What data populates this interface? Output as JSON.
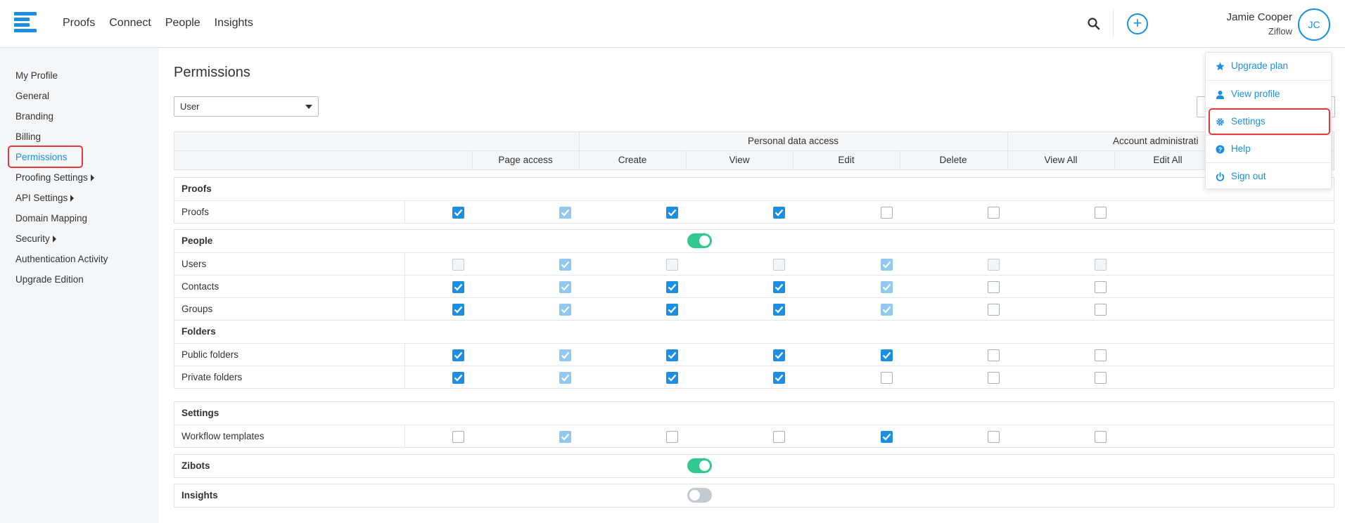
{
  "nav": {
    "items": [
      "Proofs",
      "Connect",
      "People",
      "Insights"
    ]
  },
  "user": {
    "name": "Jamie Cooper",
    "org": "Ziflow",
    "initials": "JC"
  },
  "sidebar": {
    "items": [
      {
        "label": "My Profile"
      },
      {
        "label": "General"
      },
      {
        "label": "Branding"
      },
      {
        "label": "Billing"
      },
      {
        "label": "Permissions",
        "active": true
      },
      {
        "label": "Proofing Settings",
        "caret": true
      },
      {
        "label": "API Settings",
        "caret": true
      },
      {
        "label": "Domain Mapping"
      },
      {
        "label": "Security",
        "caret": true
      },
      {
        "label": "Authentication Activity"
      },
      {
        "label": "Upgrade Edition"
      }
    ]
  },
  "page": {
    "title": "Permissions",
    "role_select": "User"
  },
  "table": {
    "group_headers": [
      "Personal data access",
      "Account administrati"
    ],
    "columns": [
      "Page access",
      "Create",
      "View",
      "Edit",
      "Delete",
      "View All",
      "Edit All"
    ],
    "sections": [
      {
        "title": "Proofs",
        "rows": [
          {
            "label": "Proofs",
            "cells": [
              "on",
              "on-light",
              "on",
              "on",
              "off",
              "off",
              "off"
            ]
          }
        ]
      },
      {
        "title": "People",
        "toggle": "on",
        "rows": [
          {
            "label": "Users",
            "cells": [
              "off-light",
              "on-light",
              "off-light",
              "off-light",
              "on-light",
              "off-light",
              "off-light"
            ]
          },
          {
            "label": "Contacts",
            "cells": [
              "on",
              "on-light",
              "on",
              "on",
              "on-light",
              "off",
              "off"
            ]
          },
          {
            "label": "Groups",
            "cells": [
              "on",
              "on-light",
              "on",
              "on",
              "on-light",
              "off",
              "off"
            ]
          }
        ]
      },
      {
        "title": "Folders",
        "rows": [
          {
            "label": "Public folders",
            "cells": [
              "on",
              "on-light",
              "on",
              "on",
              "on",
              "off",
              "off"
            ]
          },
          {
            "label": "Private folders",
            "cells": [
              "on",
              "on-light",
              "on",
              "on",
              "off",
              "off",
              "off"
            ]
          }
        ]
      },
      {
        "title": "Settings",
        "rows": [
          {
            "label": "Workflow templates",
            "cells": [
              "off",
              "on-light",
              "off",
              "off",
              "on",
              "off",
              "off"
            ]
          }
        ]
      },
      {
        "title": "Zibots",
        "toggle": "on",
        "rows": []
      },
      {
        "title": "Insights",
        "toggle": "off",
        "rows": []
      }
    ]
  },
  "menu": {
    "items": [
      {
        "label": "Upgrade plan",
        "icon": "star-icon"
      },
      {
        "label": "View profile",
        "icon": "user-icon"
      },
      {
        "label": "Settings",
        "icon": "gear-icon",
        "highlighted": true
      },
      {
        "label": "Help",
        "icon": "help-icon"
      },
      {
        "label": "Sign out",
        "icon": "power-icon"
      }
    ]
  },
  "colors": {
    "accent": "#1a8fe3",
    "toggle_on": "#2fca91",
    "highlight": "#e03a3a"
  }
}
